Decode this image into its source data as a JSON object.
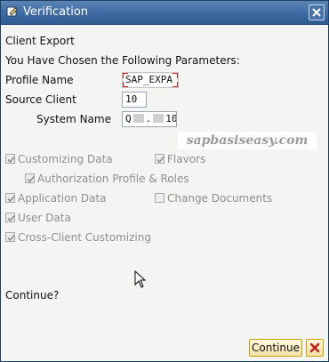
{
  "window": {
    "title": "Verification",
    "close_icon": "close-icon"
  },
  "heading": "Client Export",
  "intro": "You Have Chosen the Following Parameters:",
  "params": {
    "profile_label": "Profile Name",
    "profile_value": "SAP_EXPA",
    "source_client_label": "Source Client",
    "source_client_value": "10",
    "system_name_label": "System Name",
    "system_name_prefix": "Q",
    "system_name_sep": ".",
    "system_name_suffix": "10"
  },
  "watermark": "sapbasiseasy.com",
  "options": {
    "customizing_data": {
      "label": "Customizing Data",
      "checked": true
    },
    "flavors": {
      "label": "Flavors",
      "checked": true
    },
    "auth_profile_roles": {
      "label": "Authorization Profile & Roles",
      "checked": true
    },
    "application_data": {
      "label": "Application Data",
      "checked": true
    },
    "change_documents": {
      "label": "Change Documents",
      "checked": false
    },
    "user_data": {
      "label": "User Data",
      "checked": true
    },
    "cross_client": {
      "label": "Cross-Client Customizing",
      "checked": true
    }
  },
  "question": "Continue?",
  "buttons": {
    "continue_label": "Continue",
    "cancel_icon": "cancel-icon"
  },
  "colors": {
    "titlebar": "#3e6aa3",
    "button_border": "#c9a200",
    "cancel_red": "#c81e1e"
  }
}
